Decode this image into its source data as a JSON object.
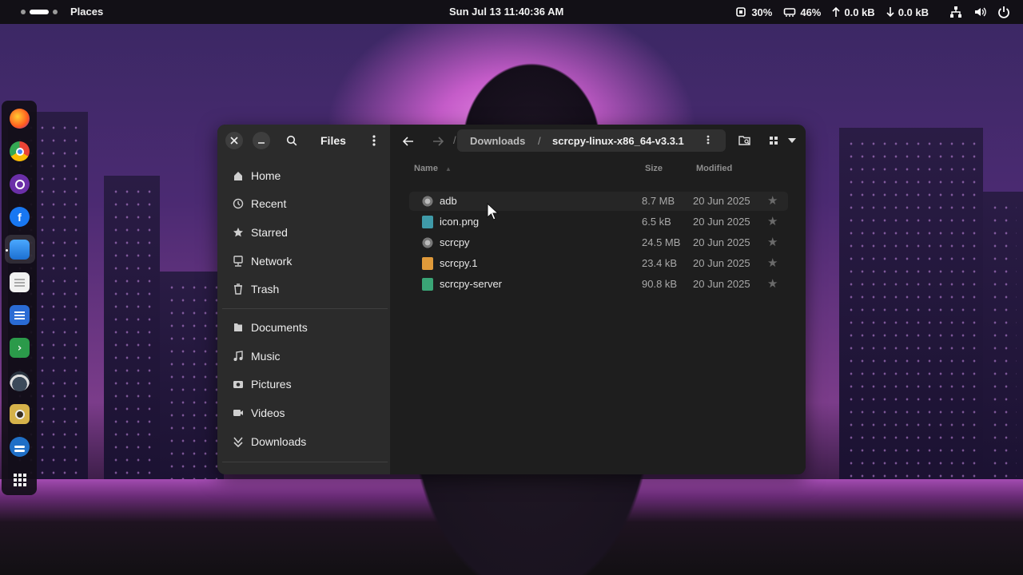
{
  "topbar": {
    "activity_label": "Places",
    "clock": "Sun Jul 13  11:40:36 AM",
    "cpu": "30%",
    "memory": "46%",
    "upload": "0.0 kB",
    "download": "0.0 kB",
    "icons": [
      "cpu-icon",
      "memory-icon",
      "upload-arrow-icon",
      "download-arrow-icon",
      "network-icon",
      "volume-icon",
      "power-icon"
    ]
  },
  "dock": {
    "apps": [
      "firefox",
      "chrome",
      "tor-browser",
      "facebook",
      "files",
      "text-editor",
      "writer",
      "terminal",
      "system-monitor",
      "speaker",
      "settings",
      "app-grid"
    ]
  },
  "window": {
    "title": "Files",
    "sidebar": {
      "places": [
        {
          "label": "Home",
          "icon": "home-icon"
        },
        {
          "label": "Recent",
          "icon": "clock-icon"
        },
        {
          "label": "Starred",
          "icon": "star-icon"
        },
        {
          "label": "Network",
          "icon": "network-icon"
        },
        {
          "label": "Trash",
          "icon": "trash-icon"
        }
      ],
      "bookmarks": [
        {
          "label": "Documents",
          "icon": "documents-icon"
        },
        {
          "label": "Music",
          "icon": "music-icon"
        },
        {
          "label": "Pictures",
          "icon": "camera-icon"
        },
        {
          "label": "Videos",
          "icon": "video-icon"
        },
        {
          "label": "Downloads",
          "icon": "download-icon"
        }
      ]
    },
    "path": {
      "parent": "Downloads",
      "separator": "/",
      "current": "scrcpy-linux-x86_64-v3.3.1"
    },
    "columns": {
      "name": "Name",
      "size": "Size",
      "modified": "Modified"
    },
    "files": [
      {
        "name": "adb",
        "size": "8.7 MB",
        "modified": "20 Jun 2025",
        "kind": "executable",
        "color": "#9a9a9a"
      },
      {
        "name": "icon.png",
        "size": "6.5 kB",
        "modified": "20 Jun 2025",
        "kind": "image",
        "color": "#3f9aa8"
      },
      {
        "name": "scrcpy",
        "size": "24.5 MB",
        "modified": "20 Jun 2025",
        "kind": "executable",
        "color": "#9a9a9a"
      },
      {
        "name": "scrcpy.1",
        "size": "23.4 kB",
        "modified": "20 Jun 2025",
        "kind": "document",
        "color": "#e09a3a"
      },
      {
        "name": "scrcpy-server",
        "size": "90.8 kB",
        "modified": "20 Jun 2025",
        "kind": "archive",
        "color": "#3aa576"
      }
    ]
  }
}
